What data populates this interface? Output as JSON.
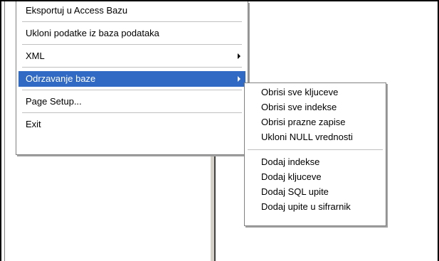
{
  "main_menu": {
    "items": [
      {
        "label": "Eksportuj u  Access Bazu"
      },
      {
        "label": "Ukloni podatke iz baza podataka"
      },
      {
        "label": "XML"
      },
      {
        "label": "Odrzavanje baze"
      },
      {
        "label": "Page Setup..."
      },
      {
        "label": "Exit"
      }
    ]
  },
  "sub_menu": {
    "items": [
      {
        "label": "Obrisi sve kljuceve"
      },
      {
        "label": "Obrisi sve indekse"
      },
      {
        "label": "Obrisi prazne zapise"
      },
      {
        "label": "Ukloni NULL vrednosti"
      },
      {
        "label": "Dodaj indekse"
      },
      {
        "label": "Dodaj kljuceve"
      },
      {
        "label": "Dodaj SQL upite"
      },
      {
        "label": "Dodaj upite u sifrarnik"
      }
    ]
  },
  "colors": {
    "highlight": "#316ac5",
    "menu_background": "#ffffff",
    "separator": "#c0c0c0"
  }
}
